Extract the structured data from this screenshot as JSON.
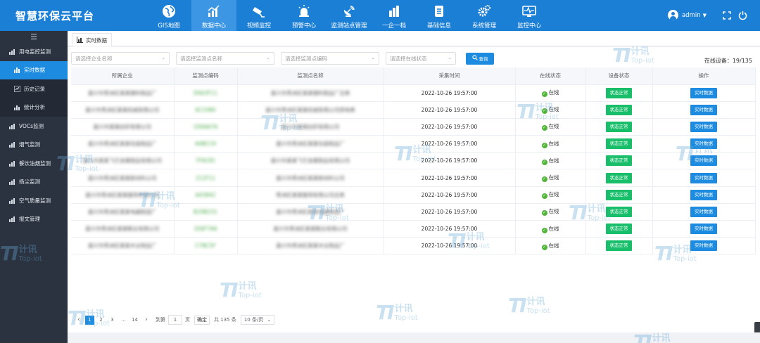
{
  "app": {
    "title": "智慧环保云平台"
  },
  "nav": [
    {
      "label": "GIS地图",
      "icon": "globe-icon"
    },
    {
      "label": "数据中心",
      "icon": "bar-chart-icon",
      "active": true
    },
    {
      "label": "视频监控",
      "icon": "camera-icon"
    },
    {
      "label": "预警中心",
      "icon": "alarm-icon"
    },
    {
      "label": "监测站点管理",
      "icon": "satellite-icon"
    },
    {
      "label": "一企一档",
      "icon": "building-icon"
    },
    {
      "label": "基础信息",
      "icon": "clipboard-icon"
    },
    {
      "label": "系统管理",
      "icon": "gears-icon"
    },
    {
      "label": "监控中心",
      "icon": "monitor-icon"
    }
  ],
  "user": {
    "name": "admin"
  },
  "sidebar": {
    "items": [
      {
        "label": "用电监控监测",
        "level": 1
      },
      {
        "label": "实时数据",
        "level": 2,
        "active": true
      },
      {
        "label": "历史记录",
        "level": 2
      },
      {
        "label": "统计分析",
        "level": 2
      },
      {
        "label": "VOCs监测",
        "level": 1
      },
      {
        "label": "烟气监测",
        "level": 1
      },
      {
        "label": "餐饮油烟监测",
        "level": 1
      },
      {
        "label": "扬尘监测",
        "level": 1
      },
      {
        "label": "空气质量监测",
        "level": 1
      },
      {
        "label": "报文管理",
        "level": 1
      }
    ]
  },
  "tab": {
    "label": "实时数据"
  },
  "filters": {
    "enterprise_placeholder": "请选择企业名称",
    "point_name_placeholder": "请选择监测点名称",
    "point_code_placeholder": "请选择监测点编码",
    "online_placeholder": "请选择在线状态",
    "query_label": "查询"
  },
  "online_count": "在线设备：19/135",
  "table": {
    "headers": [
      "所属企业",
      "监测点编码",
      "监测点名称",
      "采集时间",
      "在线状态",
      "设备状态",
      "操作"
    ],
    "rows": [
      {
        "company": "嘉兴市秀洲区某某塑料制品厂",
        "code": "D063F11",
        "name": "嘉兴市秀洲区某某塑料制品厂总表",
        "time": "2022-10-26 19:57:00",
        "online": "在线",
        "status": "状态正常",
        "action": "实时数据"
      },
      {
        "company": "嘉兴市秀洲区某某机械有限公司",
        "code": "6C3380",
        "name": "嘉兴市秀洲区某某机械有限公司用电表",
        "time": "2022-10-26 19:57:00",
        "online": "在线",
        "status": "状态正常",
        "action": "实时数据"
      },
      {
        "company": "嘉兴市某某纺织有限公司",
        "code": "1D0A676",
        "name": "嘉兴市某某纺织有限公司",
        "time": "2022-10-26 19:57:00",
        "online": "在线",
        "status": "状态正常",
        "action": "实时数据"
      },
      {
        "company": "嘉兴市秀洲区某某包装制品厂",
        "code": "A4BC19",
        "name": "嘉兴市秀洲区某某包装制品厂",
        "time": "2022-10-26 19:57:00",
        "online": "在线",
        "status": "状态正常",
        "action": "实时数据"
      },
      {
        "company": "嘉兴市某某飞艺金属制品有限公司",
        "code": "7F6C81",
        "name": "嘉兴市某某飞艺金属制品有限公司",
        "time": "2022-10-26 19:57:00",
        "online": "在线",
        "status": "状态正常",
        "action": "实时数据"
      },
      {
        "company": "嘉兴市秀洲区某某新材料公司",
        "code": "212F11",
        "name": "嘉兴市秀洲区某某新材料公司",
        "time": "2022-10-26 19:57:00",
        "online": "在线",
        "status": "状态正常",
        "action": "实时数据"
      },
      {
        "company": "嘉兴市秀洲区某某服饰有限公司",
        "code": "A43842",
        "name": "秀洲区某某服饰有限公司总表",
        "time": "2022-10-26 19:57:00",
        "online": "在线",
        "status": "状态正常",
        "action": "实时数据"
      },
      {
        "company": "嘉兴市秀洲区某某电器制造厂",
        "code": "B29B231",
        "name": "嘉兴市秀洲区某某电器制造厂",
        "time": "2022-10-26 19:57:00",
        "online": "在线",
        "status": "状态正常",
        "action": "实时数据"
      },
      {
        "company": "嘉兴市秀洲区某某鞋业有限公司",
        "code": "1E6F7A6",
        "name": "嘉兴市秀洲区某某鞋业有限公司",
        "time": "2022-10-26 19:57:00",
        "online": "在线",
        "status": "状态正常",
        "action": "实时数据"
      },
      {
        "company": "嘉兴市秀洲区某某木业制品厂",
        "code": "C7BC5F",
        "name": "嘉兴市秀洲区某某木业制品厂",
        "time": "2022-10-26 19:57:00",
        "online": "在线",
        "status": "状态正常",
        "action": "实时数据"
      }
    ]
  },
  "pager": {
    "pages": [
      "1",
      "2",
      "3",
      "...",
      "14"
    ],
    "current": "1",
    "goto_prefix": "到第",
    "goto_value": "1",
    "goto_suffix": "页",
    "confirm": "确定",
    "total": "共 135 条",
    "page_size": "10 条/页"
  },
  "watermark": {
    "mark": "TI",
    "cn": "计讯",
    "en": "Top-iot"
  },
  "colors": {
    "primary": "#1c7fd6",
    "active_nav": "#3c96e4",
    "sidebar": "#2b3340",
    "success": "#19be6b",
    "button": "#1d8ce0"
  }
}
